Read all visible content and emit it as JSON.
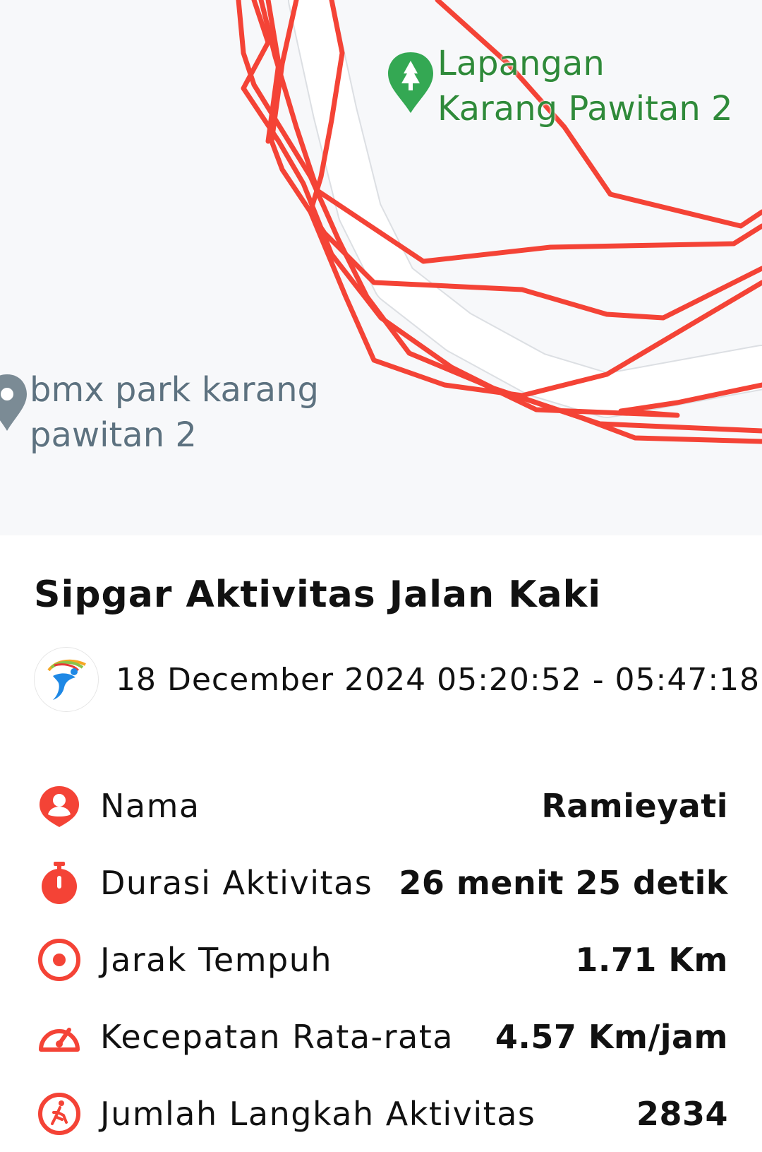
{
  "map": {
    "poi_park": {
      "name_line1": "Lapangan",
      "name_line2": "Karang Pawitan 2",
      "icon": "park-pin-icon",
      "color": "#2f8a3a"
    },
    "poi_bmx": {
      "name_line1": "bmx park karang",
      "name_line2": "pawitan 2",
      "icon": "place-pin-icon",
      "color": "#5d7280"
    },
    "route_color": "#f44336"
  },
  "activity": {
    "title": "Sipgar Aktivitas Jalan Kaki",
    "datetime": "18 December 2024 05:20:52 - 05:47:18",
    "logo_icon": "app-logo-icon"
  },
  "stats": [
    {
      "icon": "user-pin-icon",
      "label": "Nama",
      "value": "Ramieyati"
    },
    {
      "icon": "stopwatch-icon",
      "label": "Durasi Aktivitas",
      "value": "26 menit 25 detik"
    },
    {
      "icon": "target-icon",
      "label": "Jarak Tempuh",
      "value": "1.71 Km"
    },
    {
      "icon": "speedometer-icon",
      "label": "Kecepatan Rata-rata",
      "value": "4.57 Km/jam"
    },
    {
      "icon": "walking-icon",
      "label": "Jumlah Langkah Aktivitas",
      "value": "2834"
    }
  ],
  "colors": {
    "accent": "#f44336",
    "text": "#111111"
  }
}
